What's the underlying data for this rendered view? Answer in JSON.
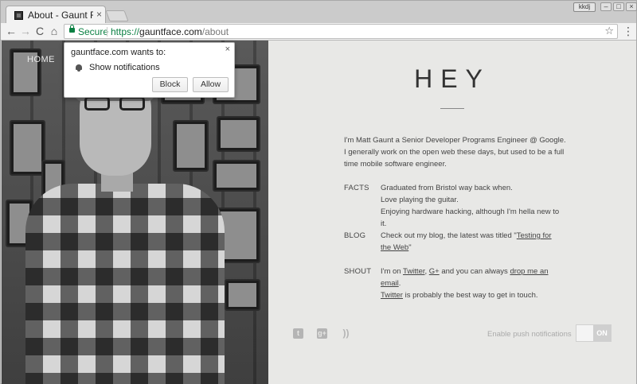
{
  "browser": {
    "tab_title": "About - Gaunt Fa",
    "tab_close": "×",
    "profile_badge": "kkdj",
    "secure_label": "Secure",
    "url_scheme": "https://",
    "url_host": "gauntface.com",
    "url_path": "/about",
    "nav": {
      "back": "←",
      "forward": "→",
      "reload": "C",
      "home": "⌂"
    },
    "star": "☆",
    "menu": "⋮"
  },
  "prompt": {
    "title": "gauntface.com wants to:",
    "close": "×",
    "permission": "Show notifications",
    "block_label": "Block",
    "allow_label": "Allow"
  },
  "site": {
    "nav_home": "HOME",
    "heading": "HEY",
    "intro": "I'm Matt Gaunt a Senior Developer Programs Engineer @ Google. I generally work on the open web these days, but used to be a full time mobile software engineer.",
    "facts": {
      "label": "FACTS",
      "lines": [
        "Graduated from Bristol way back when.",
        "Love playing the guitar.",
        "Enjoying hardware hacking, although I'm hella new to it."
      ]
    },
    "blog": {
      "label": "BLOG",
      "prefix": "Check out my blog, the latest was titled \"",
      "link": "Testing for the Web",
      "suffix": "\""
    },
    "shout": {
      "label": "SHOUT",
      "t1": "I'm on ",
      "twitter": "Twitter",
      "t2": ", ",
      "gplus": "G+",
      "t3": " and you can always ",
      "email": "drop me an email",
      "t4": ".",
      "twitter2": "Twitter",
      "t5": " is probably the best way to get in touch."
    },
    "social_icons": [
      "twitter-icon",
      "google-plus-icon",
      "rss-icon"
    ],
    "push_label": "Enable push notifications",
    "toggle_state": "ON"
  }
}
